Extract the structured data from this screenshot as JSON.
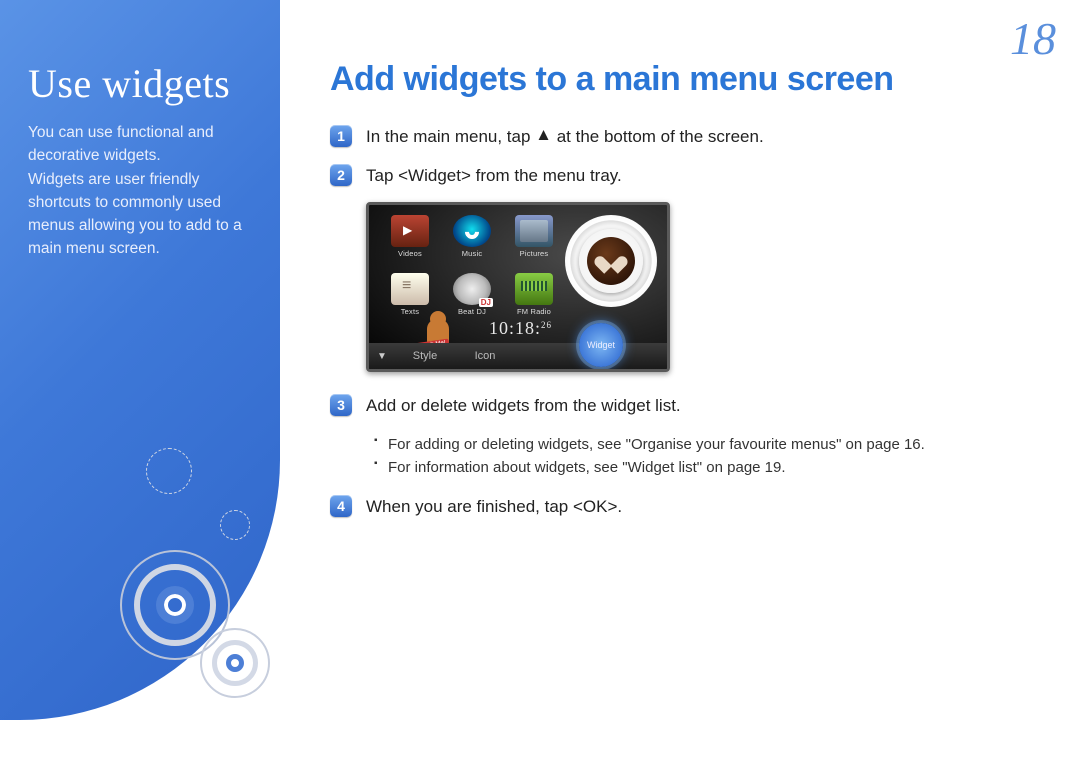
{
  "page_number": "18",
  "sidebar": {
    "title": "Use widgets",
    "body": "You can use functional and decorative widgets.\nWidgets are user friendly shortcuts to commonly used menus allowing you to add to a main menu screen."
  },
  "main": {
    "heading": "Add widgets to a main menu screen",
    "steps": [
      {
        "n": "1",
        "text_before": "In the main menu, tap ",
        "text_after": " at the bottom of the screen."
      },
      {
        "n": "2",
        "text": "Tap <Widget> from the menu tray."
      },
      {
        "n": "3",
        "text": "Add or delete widgets from the widget list."
      },
      {
        "n": "4",
        "text": "When you are finished, tap <OK>."
      }
    ],
    "sub3": [
      "For adding or deleting widgets, see \"Organise your favourite menus\" on page 16.",
      "For information about widgets, see \"Widget list\" on page 19."
    ]
  },
  "device": {
    "apps": [
      {
        "label": "Videos",
        "icon": "videos"
      },
      {
        "label": "Music",
        "icon": "music"
      },
      {
        "label": "Pictures",
        "icon": "pictures"
      },
      {
        "label": "Texts",
        "icon": "texts"
      },
      {
        "label": "Beat DJ",
        "icon": "beatdj"
      },
      {
        "label": "FM Radio",
        "icon": "fmradio"
      }
    ],
    "ginger_tag": "Touch Me!",
    "clock": "10:18:",
    "clock_sec": "26",
    "tray": {
      "style": "Style",
      "icon": "Icon",
      "widget": "Widget"
    }
  }
}
